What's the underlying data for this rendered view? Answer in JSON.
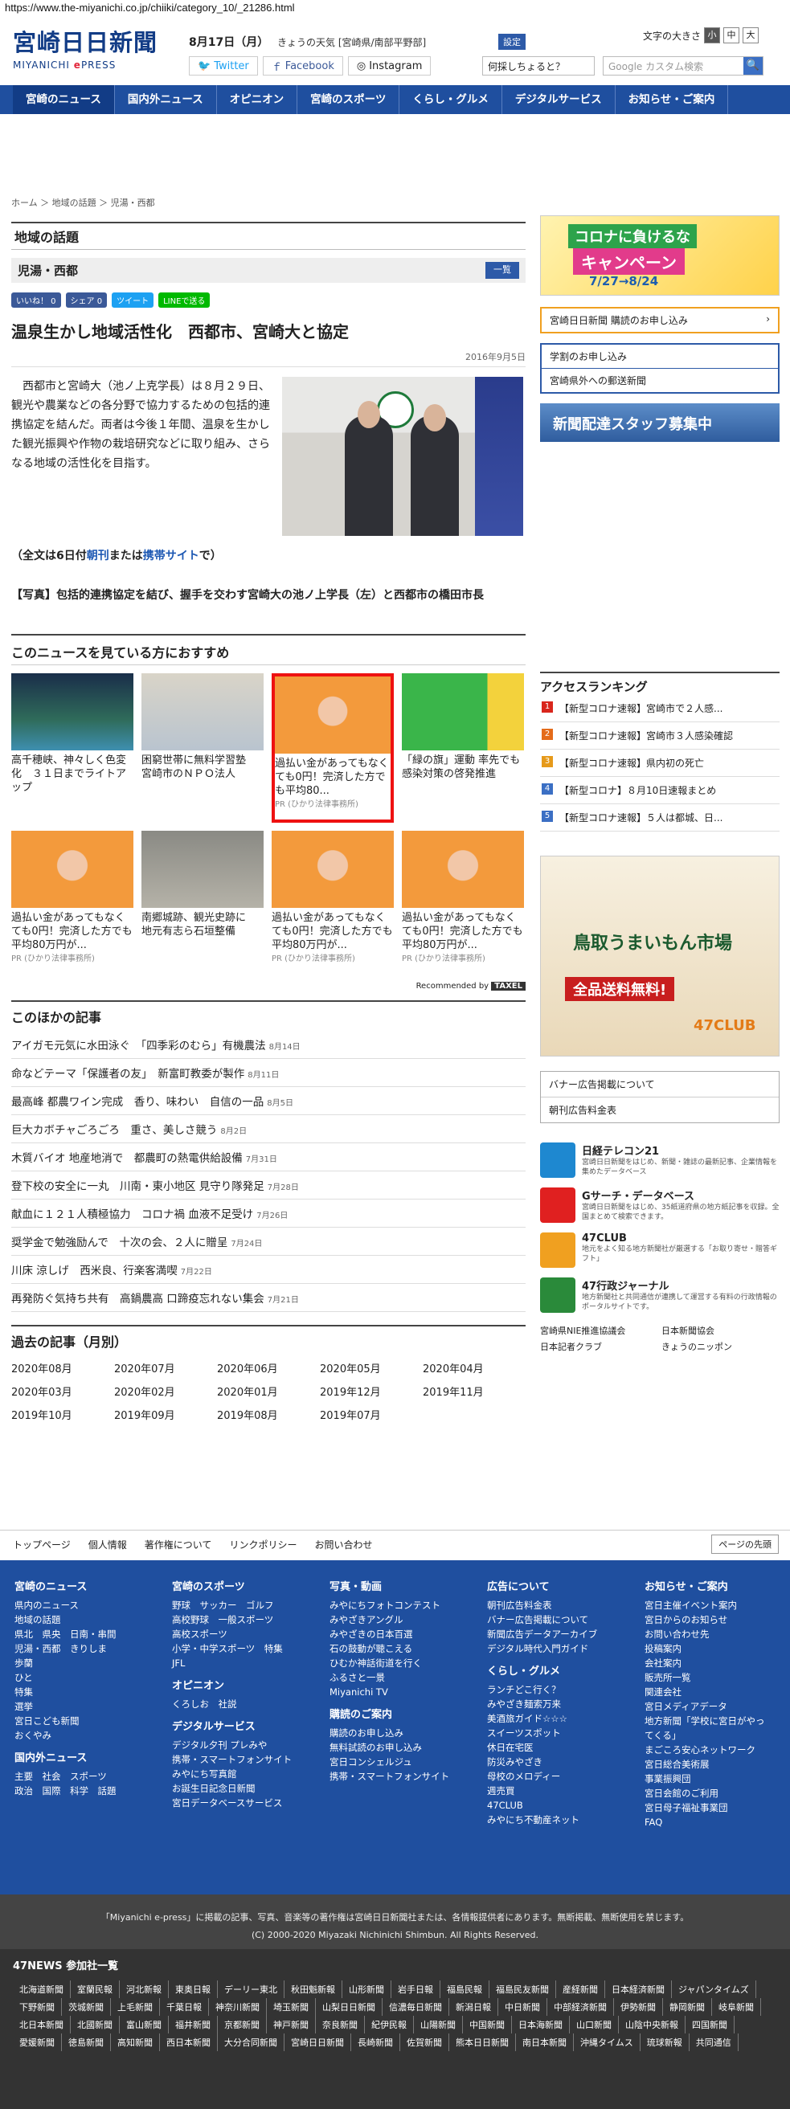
{
  "url": "https://www.the-miyanichi.co.jp/chiiki/category_10/_21286.html",
  "logo": {
    "jp": "宮崎日日新聞",
    "en1": "MIYANICHI",
    "en2": "e",
    "en3": "PRESS"
  },
  "date": "8月17日（月）",
  "weather": "きょうの天気 [宮崎県/南部平野部]",
  "weather_set": "設定",
  "fontsize": {
    "label": "文字の大きさ",
    "s": "小",
    "m": "中",
    "l": "大"
  },
  "social": {
    "twitter": "Twitter",
    "facebook": "Facebook",
    "instagram": "Instagram"
  },
  "question": "何採しちょると？",
  "search": {
    "placeholder": "Google カスタム検索"
  },
  "nav": [
    "宮崎のニュース",
    "国内外ニュース",
    "オピニオン",
    "宮崎のスポーツ",
    "くらし・グルメ",
    "デジタルサービス",
    "お知らせ・ご案内"
  ],
  "breadcrumb": "ホーム ＞ 地域の話題 ＞ 児湯・西都",
  "section": "地域の話題",
  "category": "児湯・西都",
  "list_button": "一覧",
  "shares": [
    "いいね！ 0",
    "シェア 0",
    "ツイート",
    "LINEで送る"
  ],
  "article": {
    "title": "温泉生かし地域活性化　西都市、宮崎大と協定",
    "date": "2016年9月5日",
    "body": "西都市と宮崎大（池ノ上克学長）は８月２９日、観光や農業などの各分野で協力するための包括的連携協定を結んだ。両者は今後１年間、温泉を生かした観光振興や作物の栽培研究などに取り組み、さらなる地域の活性化を目指す。",
    "full_pre": "（全文は6日付",
    "full_a": "朝刊",
    "full_mid": "または",
    "full_b": "携帯サイト",
    "full_post": "で）",
    "caption": "【写真】包括的連携協定を結び、握手を交わす宮崎大の池ノ上学長（左）と西都市の橋田市長"
  },
  "rec_title": "このニュースを見ている方におすすめ",
  "rec_cards": [
    {
      "text": "高千穂峡、神々しく色変化　３１日までライトアップ",
      "pr": ""
    },
    {
      "text": "困窮世帯に無料学習塾　宮崎市のＮＰＯ法人",
      "pr": ""
    },
    {
      "text": "過払い金があってもなくても0円！完済した方でも平均80...",
      "pr": "PR (ひかり法律事務所)"
    },
    {
      "text": "「緑の旗」運動 率先でも　感染対策の啓発推進",
      "pr": ""
    },
    {
      "text": "過払い金があってもなくても0円！完済した方でも平均80万円が...",
      "pr": "PR (ひかり法律事務所)"
    },
    {
      "text": "南郷城跡、観光史跡に　地元有志ら石垣整備",
      "pr": ""
    },
    {
      "text": "過払い金があってもなくても0円！完済した方でも平均80万円が...",
      "pr": "PR (ひかり法律事務所)"
    },
    {
      "text": "過払い金があってもなくても0円！完済した方でも平均80万円が...",
      "pr": "PR (ひかり法律事務所)"
    }
  ],
  "recommended_by": "Recommended by",
  "recommended_brand": "TAXEL",
  "others_title": "このほかの記事",
  "others": [
    {
      "t": "アイガモ元気に水田泳ぐ　「四季彩のむら」有機農法",
      "d": "8月14日"
    },
    {
      "t": "命などテーマ「保護者の友」　新富町教委が製作",
      "d": "8月11日"
    },
    {
      "t": "最高峰 都農ワイン完成　香り、味わい　自信の一品",
      "d": "8月5日"
    },
    {
      "t": "巨大カボチャごろごろ　重さ、美しさ競う",
      "d": "8月2日"
    },
    {
      "t": "木質バイオ 地産地消で　都農町の熱電供給設備",
      "d": "7月31日"
    },
    {
      "t": "登下校の安全に一丸　川南・東小地区 見守り隊発足",
      "d": "7月28日"
    },
    {
      "t": "献血に１２１人積極協力　コロナ禍 血液不足受け",
      "d": "7月26日"
    },
    {
      "t": "奨学金で勉強励んで　十次の会、２人に贈呈",
      "d": "7月24日"
    },
    {
      "t": "川床 涼しげ　西米良、行楽客満喫",
      "d": "7月22日"
    },
    {
      "t": "再発防ぐ気持ち共有　高鍋農高 口蹄疫忘れない集会",
      "d": "7月21日"
    }
  ],
  "past_title": "過去の記事（月別）",
  "months": [
    "2020年08月",
    "2020年07月",
    "2020年06月",
    "2020年05月",
    "2020年04月",
    "2020年03月",
    "2020年02月",
    "2020年01月",
    "2019年12月",
    "2019年11月",
    "2019年10月",
    "2019年09月",
    "2019年08月",
    "2019年07月"
  ],
  "side": {
    "banner": {
      "l1": "コロナに負けるな",
      "l2": "キャンペーン",
      "l3": "7/27→8/24"
    },
    "subscribe": "宮崎日日新聞 購読のお申し込み",
    "study": "学割のお申し込み",
    "mail": "宮崎県外への郵送新聞",
    "recruit": "新聞配達スタッフ募集中",
    "rank_title": "アクセスランキング",
    "rank": [
      "【新型コロナ速報】宮崎市で２人感...",
      "【新型コロナ速報】宮崎市３人感染確認",
      "【新型コロナ速報】県内初の死亡",
      "【新型コロナ】８月10日速報まとめ",
      "【新型コロナ速報】５人は都城、日..."
    ],
    "ad": {
      "a1": "鳥取うまいもん市場",
      "a2": "全品送料無料!",
      "a3": "47CLUB"
    },
    "ad_links": [
      "バナー広告掲載について",
      "朝刊広告料金表"
    ],
    "services": [
      {
        "name": "日経テレコン21",
        "desc": "宮崎日日新聞をはじめ、新聞・雑誌の最新記事、企業情報を集めたデータベース",
        "color": "#1e88d0"
      },
      {
        "name": "Gサーチ・データベース",
        "desc": "宮崎日日新聞をはじめ、35紙道府県の地方紙記事を収録。全国まとめて検索できます。",
        "color": "#e02020"
      },
      {
        "name": "47CLUB",
        "desc": "地元をよく知る地方新聞社が厳選する「お取り寄せ・贈答ギフト」",
        "color": "#f0a020"
      },
      {
        "name": "47行政ジャーナル",
        "desc": "地方新聞社と共同通信が連携して運営する有料の行政情報のポータルサイトです。",
        "color": "#2a8a3a"
      }
    ],
    "links": [
      "宮崎県NIE推進協議会",
      "日本新聞協会",
      "日本記者クラブ",
      "きょうのニッポン"
    ]
  },
  "footer_bar": [
    "トップページ",
    "個人情報",
    "著作権について",
    "リンクポリシー",
    "お問い合わせ"
  ],
  "pagetop": "ページの先頭",
  "footer": [
    {
      "h": "宮崎のニュース",
      "items": [
        "県内のニュース",
        "地域の話題",
        "県北　県央　日南・串間",
        "児湯・西都　きりしま",
        "歩蘭",
        "ひと",
        "特集",
        "選挙",
        "宮日こども新聞",
        "おくやみ"
      ],
      "h2": "国内外ニュース",
      "items2": [
        "主要　社会　スポーツ",
        "政治　国際　科学　話題"
      ]
    },
    {
      "h": "宮崎のスポーツ",
      "items": [
        "野球　サッカー　ゴルフ",
        "高校野球　一般スポーツ",
        "高校スポーツ",
        "小学・中学スポーツ　特集",
        "JFL"
      ],
      "h2": "オピニオン",
      "items2": [
        "くろしお　社説"
      ],
      "h3": "デジタルサービス",
      "items3": [
        "デジタル夕刊 プレみや",
        "携帯・スマートフォンサイト",
        "みやにち写真館",
        "お誕生日記念日新聞",
        "宮日データベースサービス"
      ]
    },
    {
      "h": "写真・動画",
      "items": [
        "みやにちフォトコンテスト",
        "みやざきアングル",
        "みやざきの日本百選",
        "石の鼓動が聴こえる",
        "ひむか神話街道を行く",
        "ふるさと一景",
        "Miyanichi TV"
      ],
      "h2": "購読のご案内",
      "items2": [
        "購読のお申し込み",
        "無料試読のお申し込み",
        "宮日コンシェルジュ",
        "携帯・スマートフォンサイト"
      ]
    },
    {
      "h": "広告について",
      "items": [
        "朝刊広告料金表",
        "バナー広告掲載について",
        "新聞広告データアーカイブ",
        "デジタル時代入門ガイド"
      ],
      "h2": "くらし・グルメ",
      "items2": [
        "ランチどこ行く？",
        "みやざき麺索万来",
        "美酒旅ガイド☆☆☆",
        "スイーツスポット",
        "休日在宅医",
        "防災みやざき",
        "母校のメロディー",
        "週売買",
        "47CLUB",
        "みやにち不動産ネット"
      ]
    },
    {
      "h": "お知らせ・ご案内",
      "items": [
        "宮日主催イベント案内",
        "宮日からのお知らせ",
        "お問い合わせ先",
        "投稿案内",
        "会社案内",
        "販売所一覧",
        "関連会社",
        "宮日メディアデータ",
        "地方新聞「学校に宮日がやってくる」",
        "まごころ安心ネットワーク",
        "宮日総合美術展",
        "事業振興団",
        "宮日会館のご利用",
        "宮日母子福祉事業団",
        "FAQ"
      ]
    }
  ],
  "copyright1": "「Miyanichi e-press」に掲載の記事、写真、音楽等の著作権は宮崎日日新聞社または、各情報提供者にあります。無断掲載、無断使用を禁じます。",
  "copyright2": "(C) 2000-2020 Miyazaki Nichinichi Shimbun. All Rights Reserved.",
  "n47_title": "47NEWS 参加社一覧",
  "n47": [
    "北海道新聞",
    "室蘭民報",
    "河北新報",
    "東奥日報",
    "デーリー東北",
    "秋田魁新報",
    "山形新聞",
    "岩手日報",
    "福島民報",
    "福島民友新聞",
    "産経新聞",
    "日本経済新聞",
    "ジャパンタイムズ",
    "下野新聞",
    "茨城新聞",
    "上毛新聞",
    "千葉日報",
    "神奈川新聞",
    "埼玉新聞",
    "山梨日日新聞",
    "信濃毎日新聞",
    "新潟日報",
    "中日新聞",
    "中部経済新聞",
    "伊勢新聞",
    "静岡新聞",
    "岐阜新聞",
    "北日本新聞",
    "北國新聞",
    "富山新聞",
    "福井新聞",
    "京都新聞",
    "神戸新聞",
    "奈良新聞",
    "紀伊民報",
    "山陽新聞",
    "中国新聞",
    "日本海新聞",
    "山口新聞",
    "山陰中央新報",
    "四国新聞",
    "愛媛新聞",
    "徳島新聞",
    "高知新聞",
    "西日本新聞",
    "大分合同新聞",
    "宮崎日日新聞",
    "長崎新聞",
    "佐賀新聞",
    "熊本日日新聞",
    "南日本新聞",
    "沖縄タイムス",
    "琉球新報",
    "共同通信"
  ]
}
